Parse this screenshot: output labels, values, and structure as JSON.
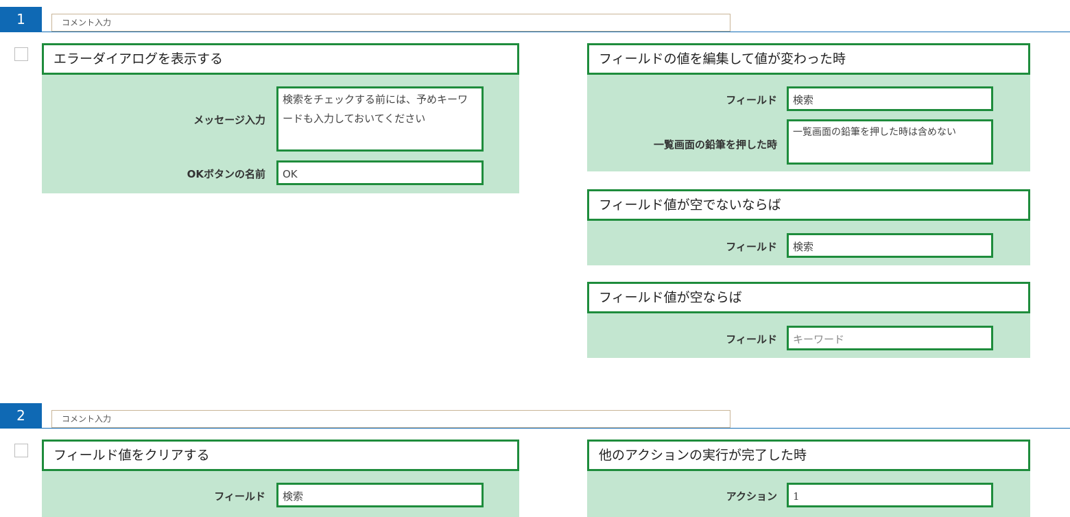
{
  "sections": [
    {
      "number": "1",
      "comment_placeholder": "コメント入力",
      "action": {
        "title": "エラーダイアログを表示する",
        "fields": [
          {
            "label": "メッセージ入力",
            "value": "検索をチェックする前には、予めキーワードも入力しておいてください"
          },
          {
            "label": "OKボタンの名前",
            "value": "OK"
          }
        ]
      },
      "conditions": [
        {
          "title": "フィールドの値を編集して値が変わった時",
          "fields": [
            {
              "label": "フィールド",
              "value": "検索"
            },
            {
              "label": "一覧画面の鉛筆を押した時",
              "value": "一覧画面の鉛筆を押した時は含めない"
            }
          ]
        },
        {
          "title": "フィールド値が空でないならば",
          "fields": [
            {
              "label": "フィールド",
              "value": "検索"
            }
          ]
        },
        {
          "title": "フィールド値が空ならば",
          "fields": [
            {
              "label": "フィールド",
              "value": "キーワード"
            }
          ]
        }
      ]
    },
    {
      "number": "2",
      "comment_placeholder": "コメント入力",
      "action": {
        "title": "フィールド値をクリアする",
        "fields": [
          {
            "label": "フィールド",
            "value": "検索"
          }
        ]
      },
      "conditions": [
        {
          "title": "他のアクションの実行が完了した時",
          "fields": [
            {
              "label": "アクション",
              "value": "1"
            }
          ]
        }
      ]
    }
  ],
  "colors": {
    "accent_blue": "#0f69b4",
    "card_green_bg": "#c3e6d0",
    "card_green_border": "#1e8c3c",
    "comment_border": "#c8b496"
  }
}
